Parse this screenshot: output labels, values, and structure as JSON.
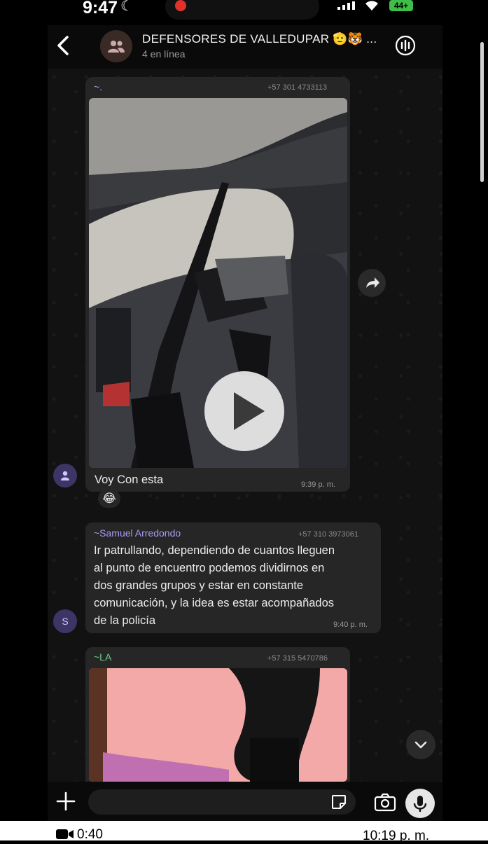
{
  "status_bar": {
    "time": "9:47",
    "battery": "44+"
  },
  "header": {
    "title": "DEFENSORES DE VALLEDUPAR 🫡🐯 ...",
    "subtitle": "4 en línea"
  },
  "messages": [
    {
      "sender": "~.",
      "phone": "+57 301 4733113",
      "text": "Voy Con esta",
      "time": "9:39 p. m.",
      "reaction": "😂"
    },
    {
      "sender": "~Samuel Arredondo",
      "phone": "+57 310 3973061",
      "avatar_initial": "S",
      "text_lines": [
        "Ir patrullando, dependiendo de cuantos lleguen",
        "al punto de encuentro podemos dividirnos en",
        "dos grandes grupos y estar en constante",
        "comunicación, y la idea es estar acompañados",
        "de la policía"
      ],
      "time": "9:40 p. m."
    },
    {
      "sender": "~LA",
      "phone": "+57 315 5470786"
    }
  ],
  "recording": {
    "duration": "0:40",
    "clock": "10:19 p. m."
  },
  "colors": {
    "sender_purple": "#a89cf0",
    "sender_green": "#6fcf8a",
    "bubble": "#262626"
  }
}
